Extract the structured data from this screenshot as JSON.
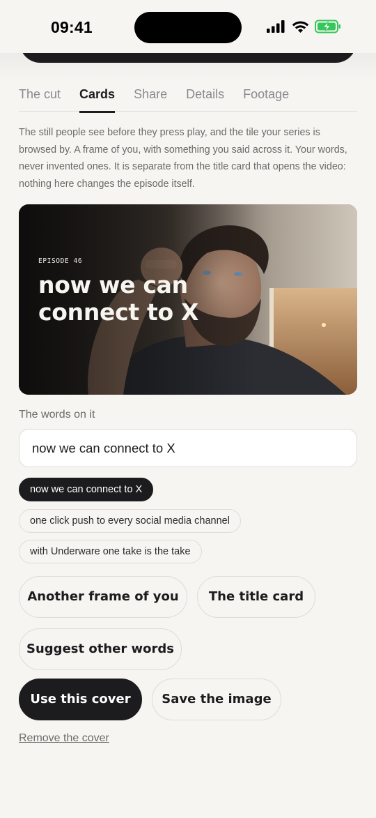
{
  "status_bar": {
    "time": "09:41"
  },
  "tabs": [
    {
      "label": "The cut"
    },
    {
      "label": "Cards"
    },
    {
      "label": "Share"
    },
    {
      "label": "Details"
    },
    {
      "label": "Footage"
    }
  ],
  "active_tab": "Cards",
  "intro_text": "The still people see before they press play, and the tile your series is browsed by. A frame of you, with something you said across it. Your words, never invented ones. It is separate from the title card that opens the video: nothing here changes the episode itself.",
  "cover": {
    "episode_label": "EPISODE 46",
    "headline": "now we can connect to X"
  },
  "words": {
    "label": "The words on it",
    "value": "now we can connect to X"
  },
  "suggestions": [
    {
      "text": "now we can connect to X",
      "selected": true
    },
    {
      "text": "one click push to every social media channel",
      "selected": false
    },
    {
      "text": "with Underware one take is the take",
      "selected": false
    }
  ],
  "actions": {
    "another_frame": "Another frame of you",
    "title_card": "The title card",
    "suggest_words": "Suggest other words",
    "use_cover": "Use this cover",
    "save_image": "Save the image",
    "remove_cover": "Remove the cover"
  },
  "colors": {
    "background": "#f6f5f2",
    "primary": "#1c1c1e",
    "muted_text": "#6b6a68",
    "border": "#dedcd8",
    "battery": "#34c759"
  }
}
